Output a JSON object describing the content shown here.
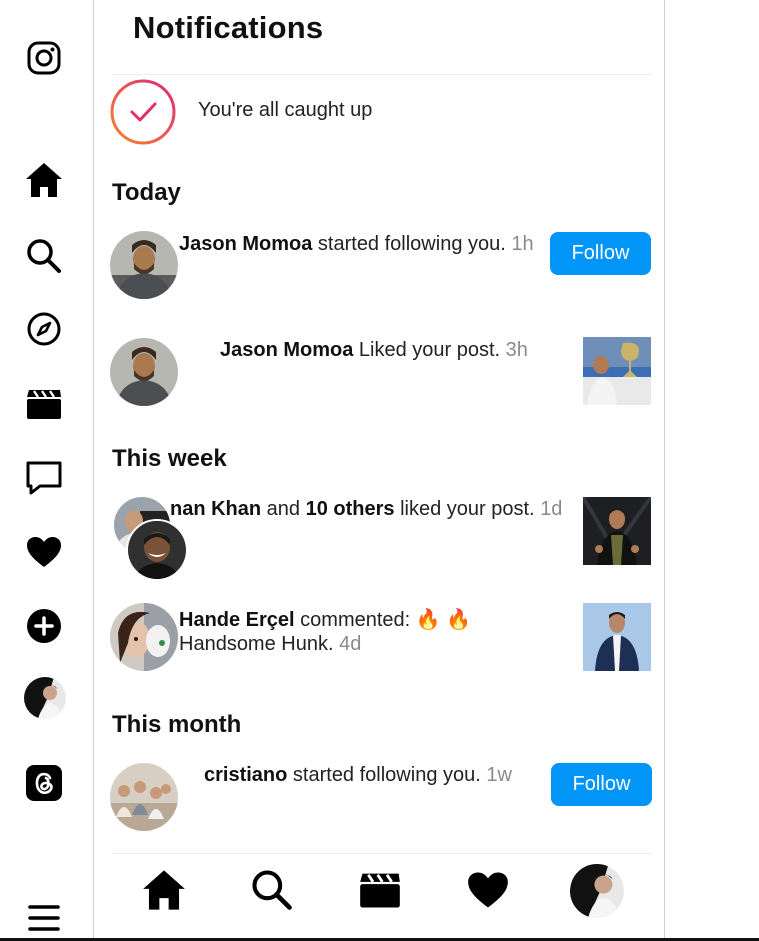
{
  "rail": {
    "icons": [
      "instagram-logo-icon",
      "home-icon",
      "search-icon",
      "explore-compass-icon",
      "reels-clapper-icon",
      "messages-bubble-icon",
      "notifications-heart-icon",
      "create-plus-icon",
      "profile-avatar",
      "threads-icon",
      "menu-hamburger-icon"
    ]
  },
  "header": {
    "title": "Notifications"
  },
  "caught_up": {
    "text": "You're all caught up"
  },
  "sections": {
    "today": "Today",
    "this_week": "This week",
    "this_month": "This month"
  },
  "notifications": [
    {
      "actor": "Jason Momoa",
      "text": " started following you.",
      "time": "1h",
      "action": "Follow"
    },
    {
      "actor": "Jason Momoa",
      "text": " Liked your post.",
      "time": "3h"
    },
    {
      "actor": "nan Khan",
      "mid": " and ",
      "others": "10 others",
      "text": " liked your post.",
      "time": "1d"
    },
    {
      "actor": "Hande Erçel",
      "text": " commented: 🔥 🔥",
      "line2": "Handsome Hunk.",
      "time": "4d"
    },
    {
      "actor": "cristiano",
      "text": " started following you.",
      "time": "1w",
      "action": "Follow"
    }
  ],
  "bottom_nav": [
    "home-icon",
    "search-icon",
    "reels-clapper-icon",
    "heart-icon",
    "profile-avatar"
  ],
  "colors": {
    "accent": "#0095f6",
    "ring_start": "#f58529",
    "ring_end": "#dd2a7b"
  }
}
